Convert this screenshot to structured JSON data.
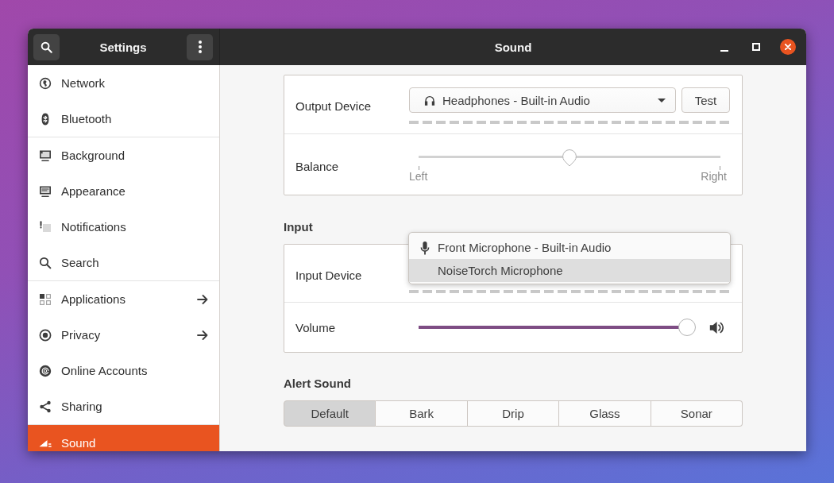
{
  "window": {
    "sidebar_title": "Settings",
    "title": "Sound"
  },
  "sidebar": {
    "groups": [
      {
        "items": [
          {
            "label": "Network",
            "submenu": false,
            "selected": false
          },
          {
            "label": "Bluetooth",
            "submenu": false,
            "selected": false
          }
        ]
      },
      {
        "items": [
          {
            "label": "Background",
            "submenu": false,
            "selected": false
          },
          {
            "label": "Appearance",
            "submenu": false,
            "selected": false
          },
          {
            "label": "Notifications",
            "submenu": false,
            "selected": false
          },
          {
            "label": "Search",
            "submenu": false,
            "selected": false
          }
        ]
      },
      {
        "items": [
          {
            "label": "Applications",
            "submenu": true,
            "selected": false
          },
          {
            "label": "Privacy",
            "submenu": true,
            "selected": false
          },
          {
            "label": "Online Accounts",
            "submenu": false,
            "selected": false
          },
          {
            "label": "Sharing",
            "submenu": false,
            "selected": false
          }
        ]
      },
      {
        "items": [
          {
            "label": "Sound",
            "submenu": false,
            "selected": true
          }
        ]
      }
    ]
  },
  "output": {
    "device": {
      "label": "Output Device",
      "value": "Headphones - Built-in Audio",
      "button": "Test"
    },
    "balance": {
      "label": "Balance",
      "level": 0.5,
      "marks": [
        "Left",
        "Right"
      ]
    }
  },
  "input": {
    "heading": "Input",
    "device": {
      "label": "Input Device",
      "menu": [
        {
          "label": "Front Microphone - Built-in Audio",
          "kind": "microphone",
          "selected": false
        },
        {
          "label": "NoiseTorch Microphone",
          "kind": "plain",
          "selected": true
        }
      ]
    },
    "volume": {
      "label": "Volume",
      "level": 1
    }
  },
  "alert_sound": {
    "heading": "Alert Sound",
    "options": [
      {
        "label": "Default",
        "selected": true
      },
      {
        "label": "Bark",
        "selected": false
      },
      {
        "label": "Drip",
        "selected": false
      },
      {
        "label": "Glass",
        "selected": false
      },
      {
        "label": "Sonar",
        "selected": false
      }
    ]
  }
}
